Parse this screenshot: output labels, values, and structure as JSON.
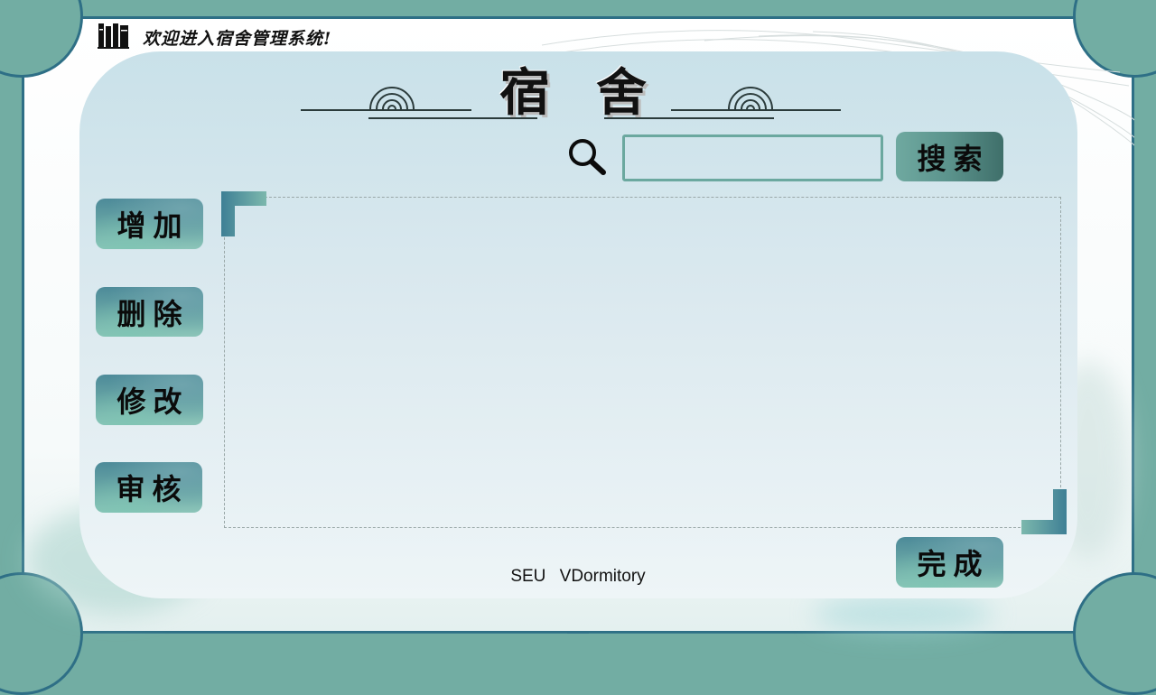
{
  "header": {
    "welcome": "欢迎进入宿舍管理系统!",
    "logo_icon": "books-icon"
  },
  "title": {
    "char1": "宿",
    "char2": "舍"
  },
  "search": {
    "icon": "magnifier-icon",
    "value": "",
    "button_label": "搜索"
  },
  "actions": [
    {
      "label": "增加"
    },
    {
      "label": "删除"
    },
    {
      "label": "修改"
    },
    {
      "label": "审核"
    }
  ],
  "done": {
    "label": "完成"
  },
  "footer": {
    "text": "SEU VDormitory"
  },
  "colors": {
    "background": "#72ada3",
    "frame_border": "#2e6f86",
    "input_border": "#6ba89f",
    "bracket": "#3e7f95"
  }
}
